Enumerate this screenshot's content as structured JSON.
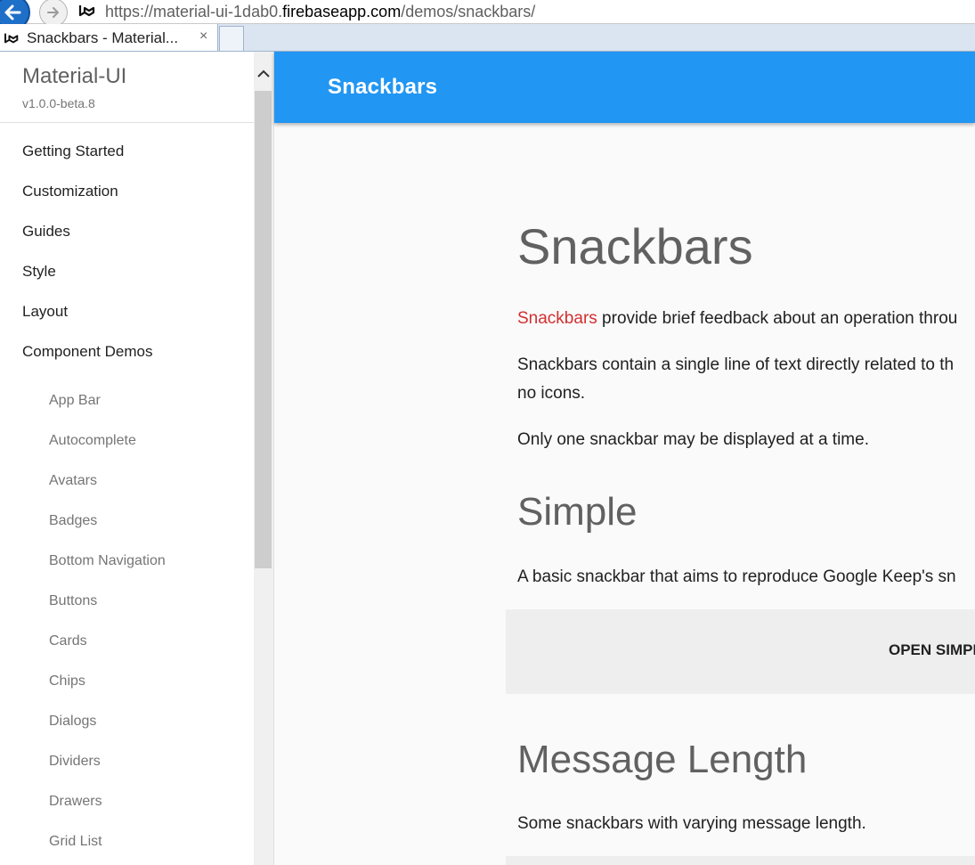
{
  "browser": {
    "url_prefix": "https://material-ui-1dab0.",
    "url_host": "firebaseapp.com",
    "url_path": "/demos/snackbars/",
    "tab_title": "Snackbars - Material...",
    "tab_close": "×"
  },
  "drawer": {
    "title": "Material-UI",
    "version": "v1.0.0-beta.8",
    "nav": [
      {
        "label": "Getting Started"
      },
      {
        "label": "Customization"
      },
      {
        "label": "Guides"
      },
      {
        "label": "Style"
      },
      {
        "label": "Layout"
      },
      {
        "label": "Component Demos"
      }
    ],
    "demos": [
      {
        "label": "App Bar"
      },
      {
        "label": "Autocomplete"
      },
      {
        "label": "Avatars"
      },
      {
        "label": "Badges"
      },
      {
        "label": "Bottom Navigation"
      },
      {
        "label": "Buttons"
      },
      {
        "label": "Cards"
      },
      {
        "label": "Chips"
      },
      {
        "label": "Dialogs"
      },
      {
        "label": "Dividers"
      },
      {
        "label": "Drawers"
      },
      {
        "label": "Grid List"
      }
    ]
  },
  "appbar": {
    "title": "Snackbars"
  },
  "main": {
    "title": "Snackbars",
    "intro_link": "Snackbars",
    "intro_rest": " provide brief feedback about an operation throu",
    "para2_line1": "Snackbars contain a single line of text directly related to th",
    "para2_line2": "no icons.",
    "para3": "Only one snackbar may be displayed at a time.",
    "simple_heading": "Simple",
    "simple_desc": "A basic snackbar that aims to reproduce Google Keep's sn",
    "open_simple_label": "OPEN SIMPL",
    "length_heading": "Message Length",
    "length_desc": "Some snackbars with varying message length."
  },
  "colors": {
    "appbar": "#2196f3",
    "link": "#d32f2f",
    "demo_bg": "#eeeeee"
  }
}
